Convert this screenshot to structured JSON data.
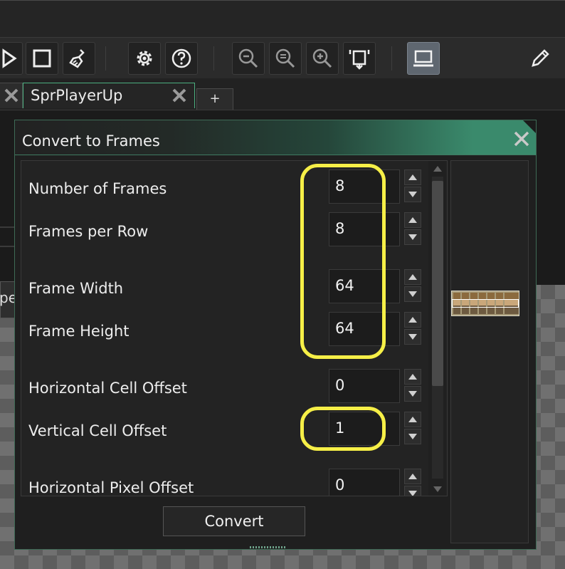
{
  "tabs": {
    "active_label": "SprPlayerUp",
    "add_label": "+"
  },
  "background_panel": {
    "partial_label": "pe"
  },
  "dialog": {
    "title": "Convert to Frames",
    "fields": [
      {
        "label": "Number of Frames",
        "value": "8"
      },
      {
        "label": "Frames per Row",
        "value": "8"
      },
      {
        "label": "Frame Width",
        "value": "64"
      },
      {
        "label": "Frame Height",
        "value": "64"
      },
      {
        "label": "Horizontal Cell Offset",
        "value": "0"
      },
      {
        "label": "Vertical Cell Offset",
        "value": "1"
      },
      {
        "label": "Horizontal Pixel Offset",
        "value": "0"
      }
    ],
    "convert_label": "Convert"
  },
  "toolbar": {
    "icons": [
      "play-icon",
      "stop-icon",
      "clean-brush-icon",
      "gear-icon",
      "help-icon",
      "zoom-out-icon",
      "zoom-reset-icon",
      "zoom-in-icon",
      "fit-icon",
      "monitor-icon",
      "pencil-icon"
    ]
  },
  "colors": {
    "accent_green": "#3a8a6c",
    "highlight_yellow": "#f6ef47"
  }
}
